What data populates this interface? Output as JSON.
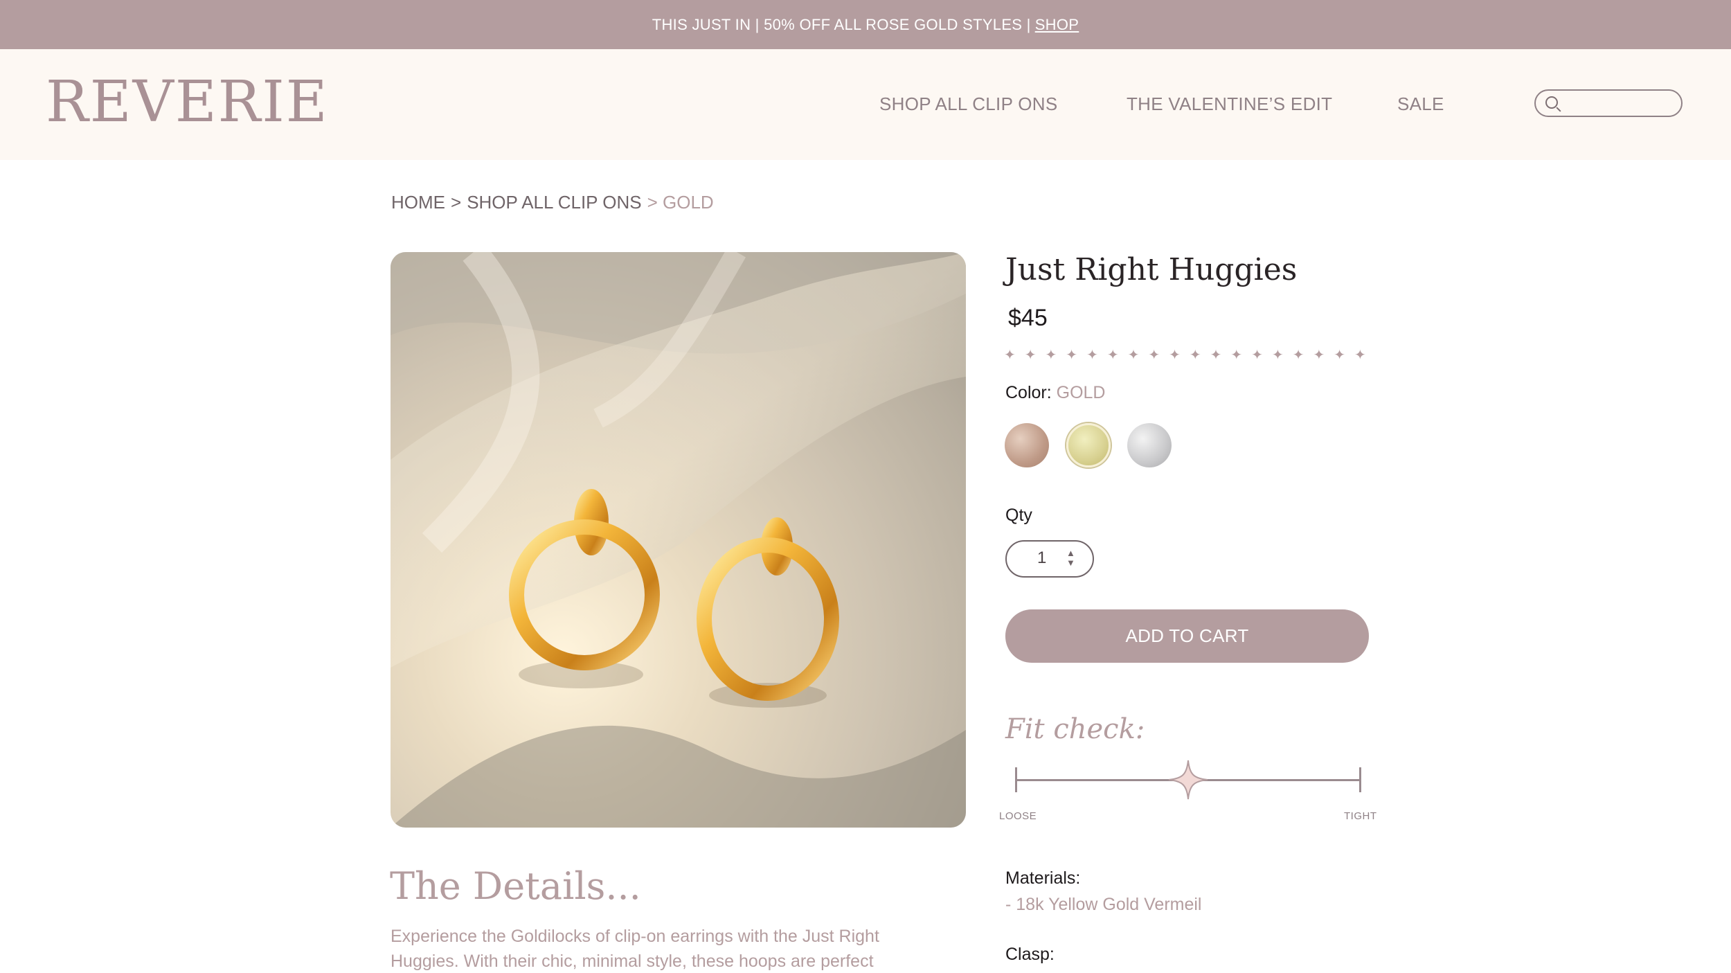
{
  "banner": {
    "text": "THIS JUST IN | 50% OFF ALL ROSE GOLD STYLES |",
    "link": "SHOP"
  },
  "header": {
    "logo": "REVERIE",
    "nav": [
      "SHOP ALL CLIP ONS",
      "THE VALENTINE’S EDIT",
      "SALE"
    ],
    "search": {
      "placeholder": ""
    }
  },
  "breadcrumb": {
    "home": "HOME",
    "sep1": ">",
    "category": "SHOP ALL CLIP ONS",
    "current": "> GOLD"
  },
  "product": {
    "title": "Just Right Huggies",
    "price": "$45",
    "color_label": "Color:",
    "color_value": "GOLD",
    "swatches": [
      "rose-gold",
      "gold",
      "silver"
    ],
    "qty_label": "Qty",
    "qty_value": "1",
    "add_to_cart": "ADD TO CART",
    "fit_title": "Fit check:",
    "fit": {
      "min_label": "LOOSE",
      "max_label": "TIGHT",
      "level": 0.5
    },
    "materials_label": "Materials:",
    "materials_value": "- 18k Yellow Gold Vermeil",
    "clasp_label": "Clasp:"
  },
  "details": {
    "title": "The Details...",
    "text": "Experience the Goldilocks of clip-on earrings with the Just Right Huggies. With their chic, minimal style, these hoops are perfect"
  },
  "colors": {
    "accent": "#b49d9f",
    "header_bg": "#fdf8f3"
  }
}
